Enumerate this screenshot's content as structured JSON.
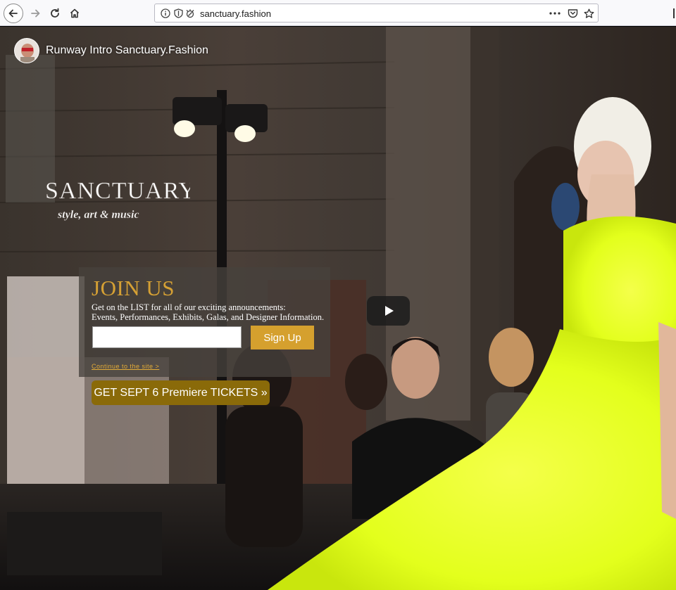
{
  "browser": {
    "url": "sanctuary.fashion",
    "icons": [
      "back-arrow-icon",
      "forward-arrow-icon",
      "reload-icon",
      "home-icon",
      "info-icon",
      "shield-icon",
      "permissions-icon",
      "more-icon",
      "pocket-icon",
      "bookmark-star-icon"
    ]
  },
  "video": {
    "title": "Runway Intro Sanctuary.Fashion",
    "play_icon": "play-icon"
  },
  "logo": {
    "line1": "SANCTUARY",
    "line2": "style, art & music"
  },
  "signup": {
    "heading": "JOIN US",
    "description_line1": "Get on the LIST for all of our exciting announcements:",
    "description_line2": "Events, Performances, Exhibits, Galas, and Designer Information.",
    "email_value": "",
    "button_label": "Sign Up",
    "continue_link": "Continue to the site >",
    "tickets_button": "GET SEPT 6 Premiere TICKETS »"
  },
  "colors": {
    "accent_gold": "#d5a02e",
    "tickets_gold": "#8a6a09",
    "dress_yellow": "#e6ff2a"
  }
}
